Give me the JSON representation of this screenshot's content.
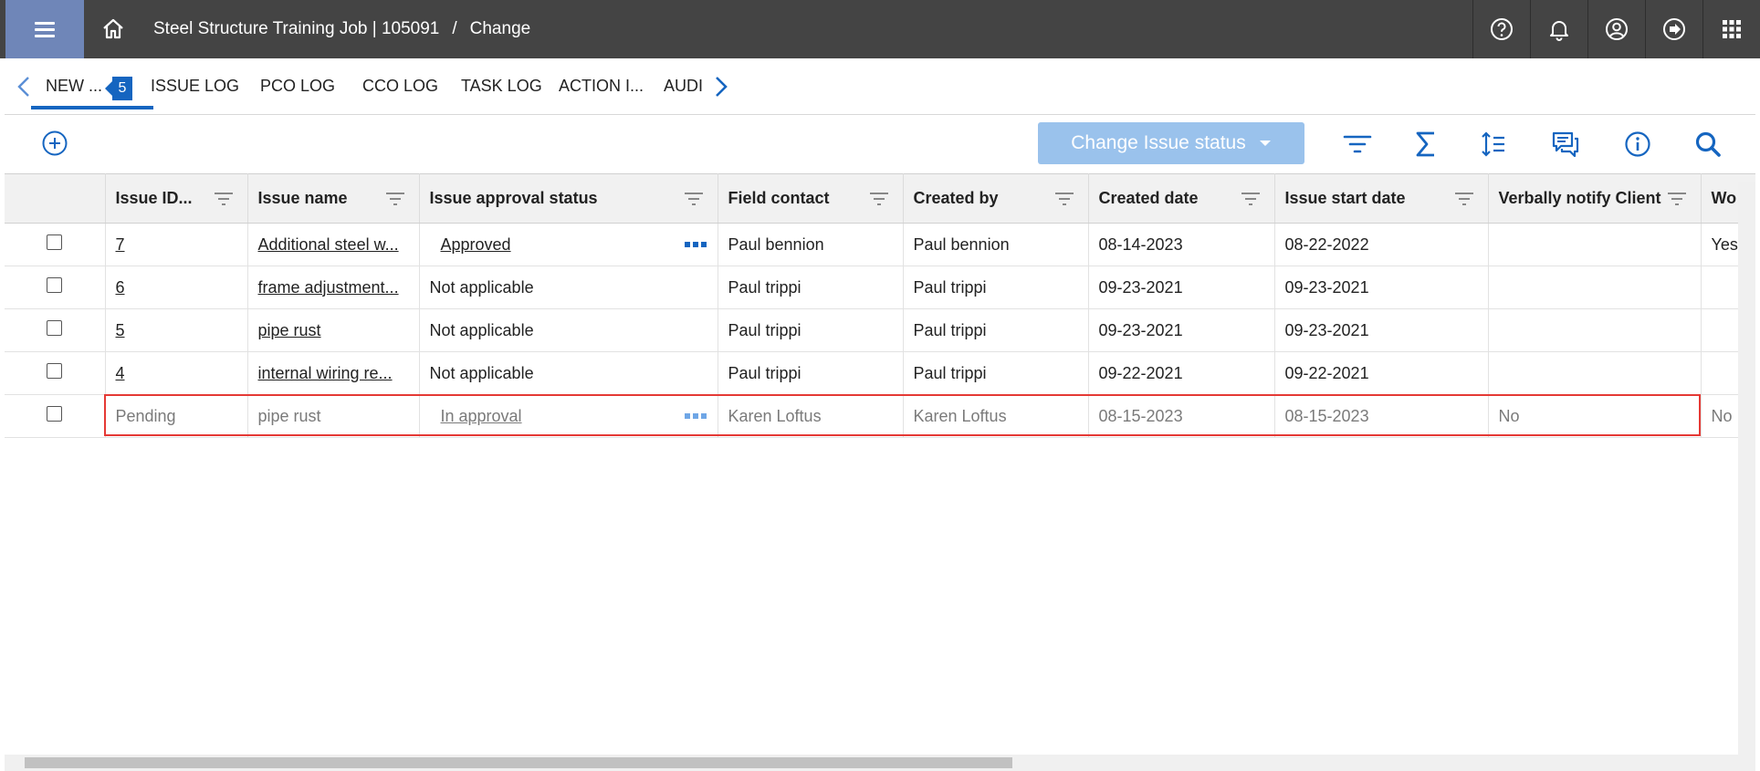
{
  "header": {
    "breadcrumb_project": "Steel Structure Training Job | 105091",
    "breadcrumb_separator": "/",
    "breadcrumb_page": "Change",
    "icons": [
      "help-icon",
      "bell-icon",
      "user-icon",
      "logout-icon",
      "apps-grid-icon"
    ]
  },
  "tabs": {
    "items": [
      {
        "label": "NEW ...",
        "active": true
      },
      {
        "label": "ISSUE LOG"
      },
      {
        "label": "PCO LOG"
      },
      {
        "label": "CCO LOG"
      },
      {
        "label": "TASK LOG"
      },
      {
        "label": "ACTION I..."
      },
      {
        "label": "AUDI"
      }
    ],
    "badge": "5"
  },
  "toolbar": {
    "status_button": "Change Issue status",
    "icons": [
      "filter-icon",
      "sum-icon",
      "row-height-icon",
      "comments-icon",
      "info-icon",
      "search-icon"
    ]
  },
  "table": {
    "columns": [
      "Issue ID...",
      "Issue name",
      "Issue approval status",
      "Field contact",
      "Created by",
      "Created date",
      "Issue start date",
      "Verbally notify Client",
      "Wo"
    ],
    "rows": [
      {
        "id": "7",
        "name": "Additional steel w...",
        "status": "Approved",
        "field_contact": "Paul bennion",
        "created_by": "Paul bennion",
        "created": "08-14-2023",
        "start": "08-22-2022",
        "verbal": "",
        "wo": "Yes"
      },
      {
        "id": "6",
        "name": "frame adjustment...",
        "status": "Not applicable",
        "field_contact": "Paul trippi",
        "created_by": "Paul trippi",
        "created": "09-23-2021",
        "start": "09-23-2021",
        "verbal": "",
        "wo": ""
      },
      {
        "id": "5",
        "name": "pipe rust",
        "status": "Not applicable",
        "field_contact": "Paul trippi",
        "created_by": "Paul trippi",
        "created": "09-23-2021",
        "start": "09-23-2021",
        "verbal": "",
        "wo": ""
      },
      {
        "id": "4",
        "name": "internal wiring re...",
        "status": "Not applicable",
        "field_contact": "Paul trippi",
        "created_by": "Paul trippi",
        "created": "09-22-2021",
        "start": "09-22-2021",
        "verbal": "",
        "wo": ""
      },
      {
        "id": "Pending",
        "name": "pipe rust",
        "status": "In approval",
        "field_contact": "Karen Loftus",
        "created_by": "Karen Loftus",
        "created": "08-15-2023",
        "start": "08-15-2023",
        "verbal": "No",
        "wo": "No"
      }
    ]
  },
  "colors": {
    "topbar": "#444444",
    "menu_button": "#6f86b8",
    "accent": "#1565c0",
    "status_button": "#9ac2ec",
    "highlight": "#e53935"
  }
}
